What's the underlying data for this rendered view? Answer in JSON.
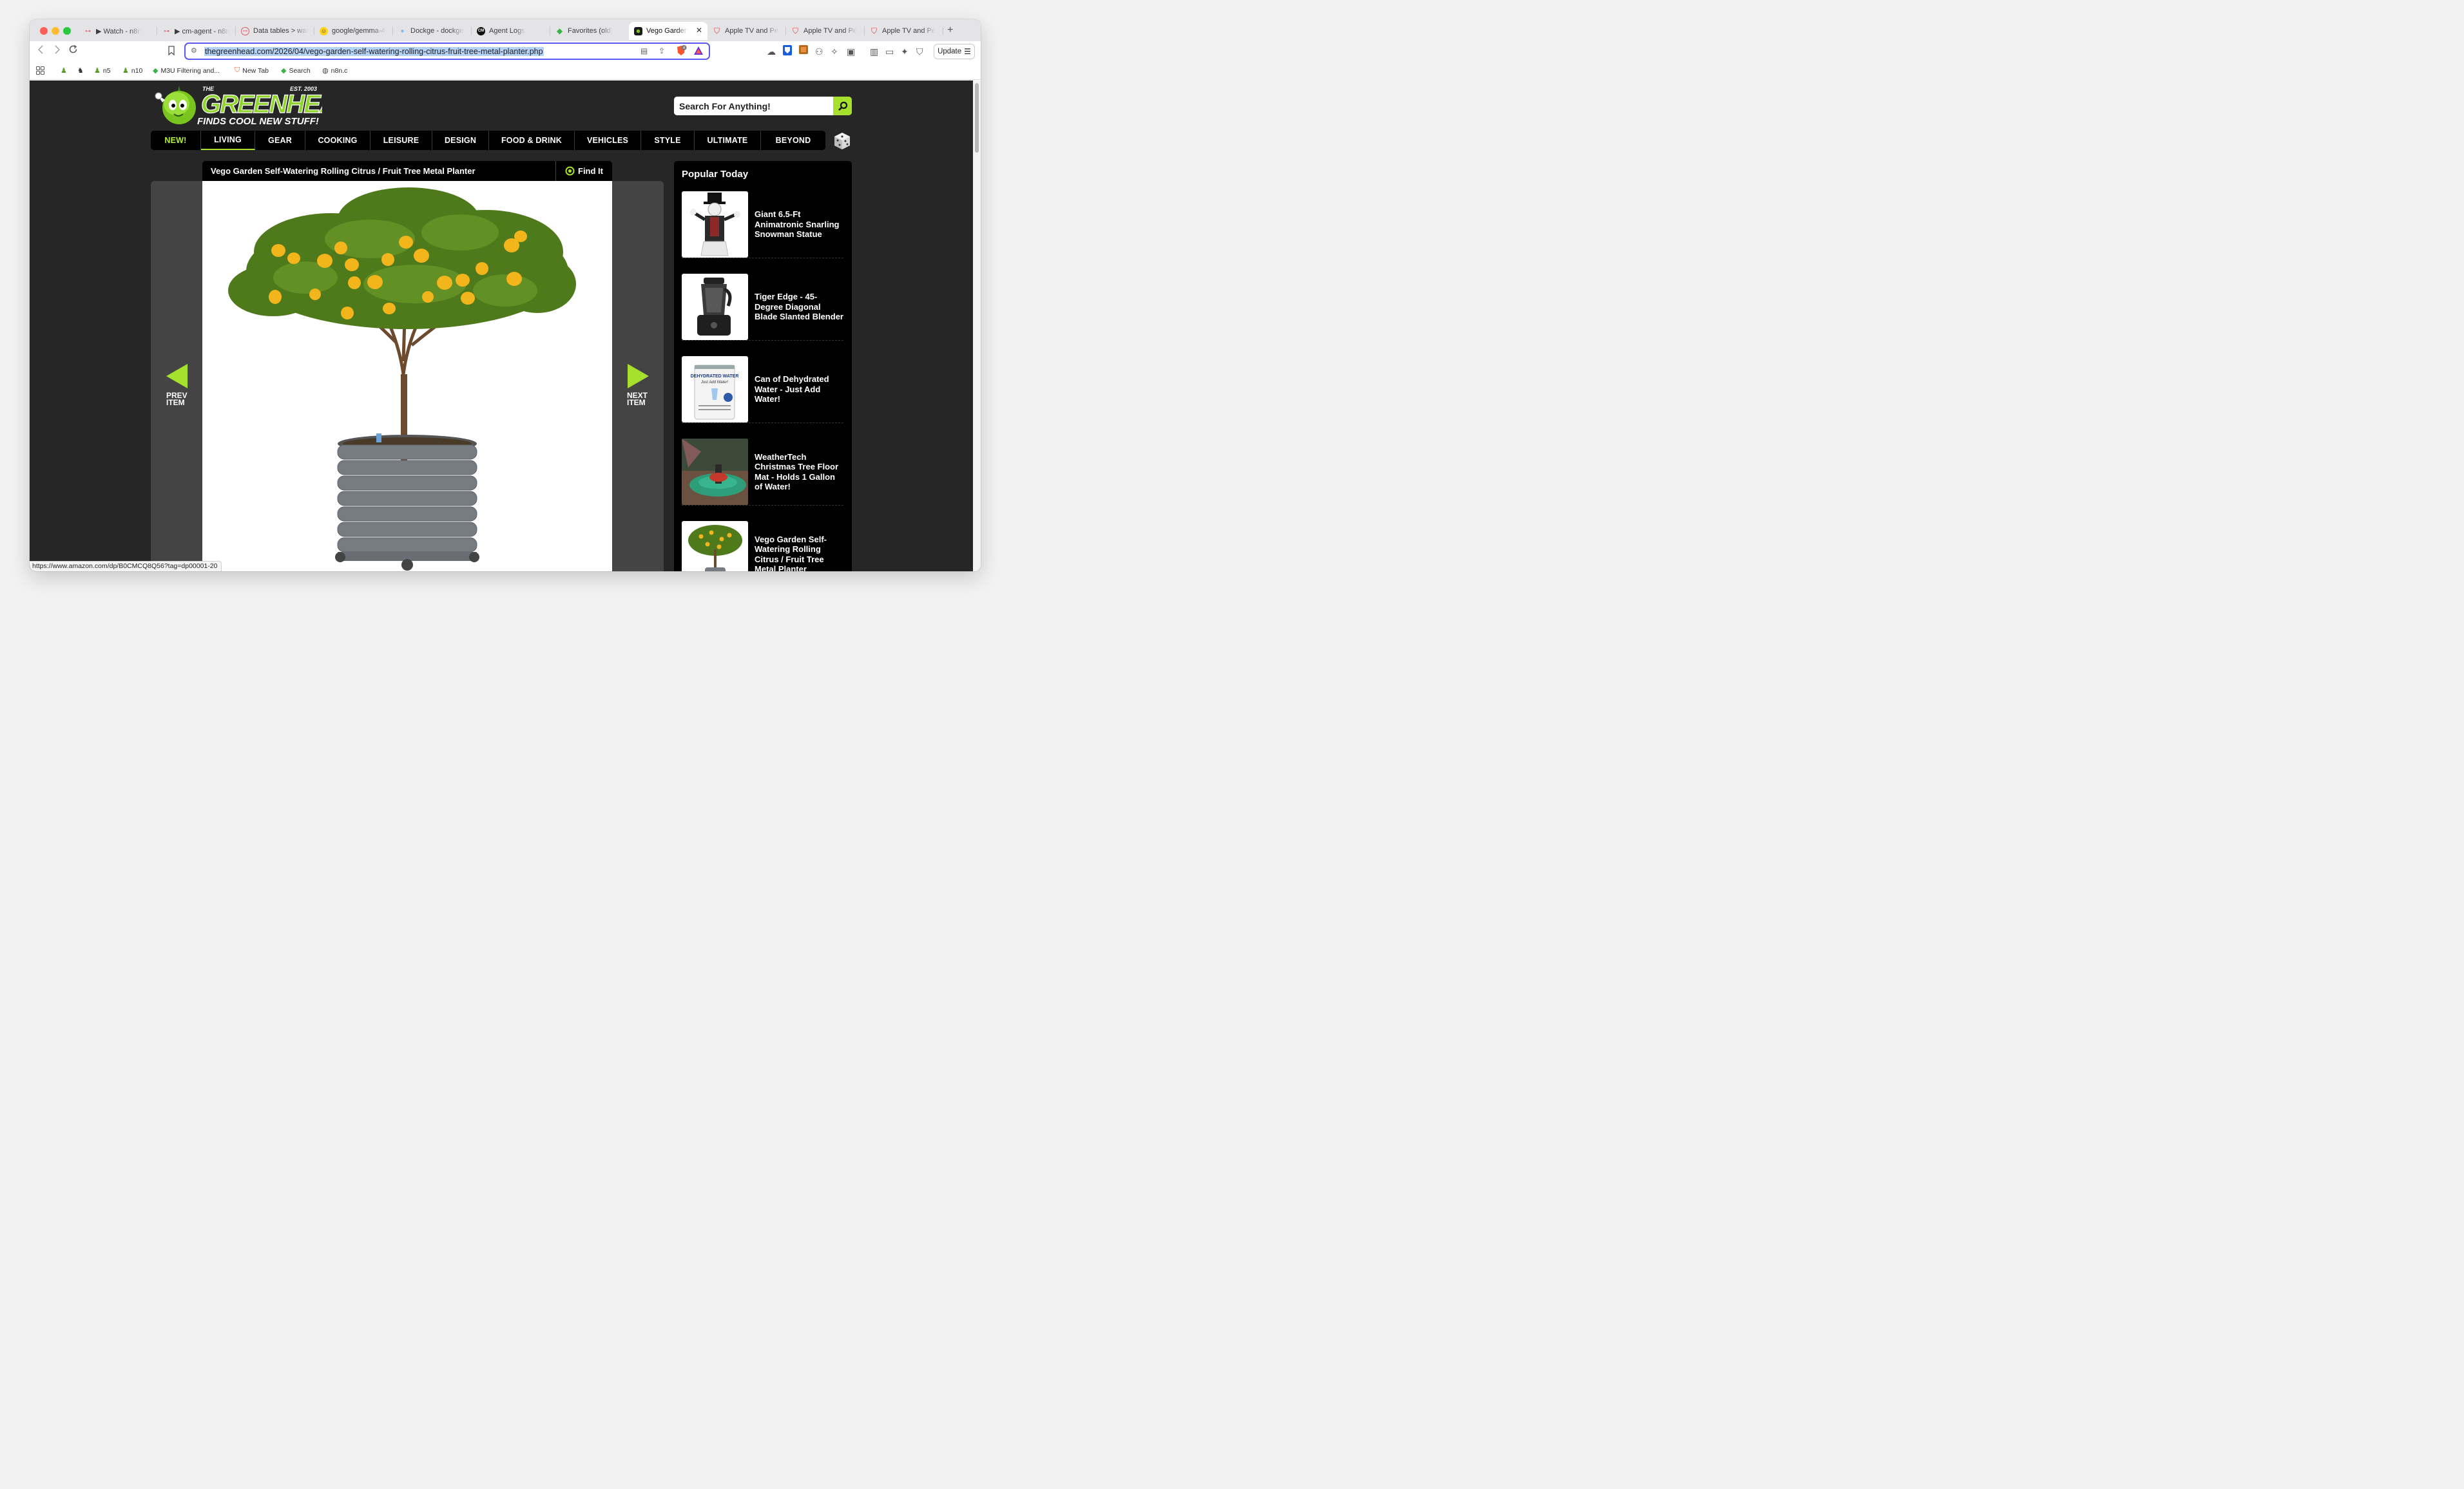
{
  "browser": {
    "tabs": [
      {
        "label": "▶ Watch - n8n",
        "icon": "n8n-icon",
        "active": false
      },
      {
        "label": "▶ cm-agent - n8n",
        "icon": "n8n-icon",
        "active": false
      },
      {
        "label": "Data tables > wat",
        "icon": "n8n-circle-icon",
        "active": false
      },
      {
        "label": "google/gemma-4",
        "icon": "hf-icon",
        "active": false
      },
      {
        "label": "Dockge - dockge",
        "icon": "dockge-icon",
        "active": false
      },
      {
        "label": "Agent Logs",
        "icon": "cm-icon",
        "active": false
      },
      {
        "label": "Favorites (old)",
        "icon": "diamond-icon",
        "active": false
      },
      {
        "label": "Vego Garden",
        "icon": "greenhead-icon",
        "active": true
      },
      {
        "label": "Apple TV and Pe",
        "icon": "shield-icon",
        "active": false
      },
      {
        "label": "Apple TV and Pe",
        "icon": "shield-icon",
        "active": false
      },
      {
        "label": "Apple TV and Pe",
        "icon": "shield-icon",
        "active": false
      }
    ],
    "url": "thegreenhead.com/2026/04/vego-garden-self-watering-rolling-citrus-fruit-tree-metal-planter.php",
    "update_label": "Update",
    "shield_badge": "4",
    "bookmarks": [
      {
        "label": "",
        "icon": "grid-icon"
      },
      {
        "label": "",
        "icon": "chess-pawn-icon"
      },
      {
        "label": "",
        "icon": "chess-knight-icon"
      },
      {
        "label": "n5",
        "icon": "chess-pawn-icon"
      },
      {
        "label": "n10",
        "icon": "chess-pawn-icon"
      },
      {
        "label": "M3U Filtering and...",
        "icon": "diamond-icon"
      },
      {
        "label": "New Tab",
        "icon": "brave-icon"
      },
      {
        "label": "Search",
        "icon": "diamond-icon"
      },
      {
        "label": "n8n.c",
        "icon": "globe-icon"
      }
    ],
    "status_url": "https://www.amazon.com/dp/B0CMCQ8Q56?tag=dp00001-20"
  },
  "site": {
    "logo_text": "THE GREEN HEAD",
    "logo_tagline": "FINDS COOL NEW STUFF!",
    "logo_est": "EST. 2003",
    "search_placeholder": "Search For Anything!",
    "nav": [
      "NEW!",
      "LIVING",
      "GEAR",
      "COOKING",
      "LEISURE",
      "DESIGN",
      "FOOD & DRINK",
      "VEHICLES",
      "STYLE",
      "ULTIMATE",
      "BEYOND"
    ],
    "nav_active": "LIVING",
    "accent_color": "#a5e02c"
  },
  "article": {
    "title": "Vego Garden Self-Watering Rolling Citrus / Fruit Tree Metal Planter",
    "find_it": "Find It",
    "prev_label_1": "PREV",
    "prev_label_2": "ITEM",
    "next_label_1": "NEXT",
    "next_label_2": "ITEM"
  },
  "sidebar": {
    "title": "Popular Today",
    "items": [
      {
        "title": "Giant 6.5-Ft Animatronic Snarling Snowman Statue"
      },
      {
        "title": "Tiger Edge - 45-Degree Diagonal Blade Slanted Blender"
      },
      {
        "title": "Can of Dehydrated Water - Just Add Water!"
      },
      {
        "title": "WeatherTech Christmas Tree Floor Mat - Holds 1 Gallon of Water!"
      },
      {
        "title": "Vego Garden Self-Watering Rolling Citrus / Fruit Tree Metal Planter"
      }
    ],
    "can_label_1": "DEHYDRATED WATER",
    "can_label_2": "Just Add Water!"
  }
}
